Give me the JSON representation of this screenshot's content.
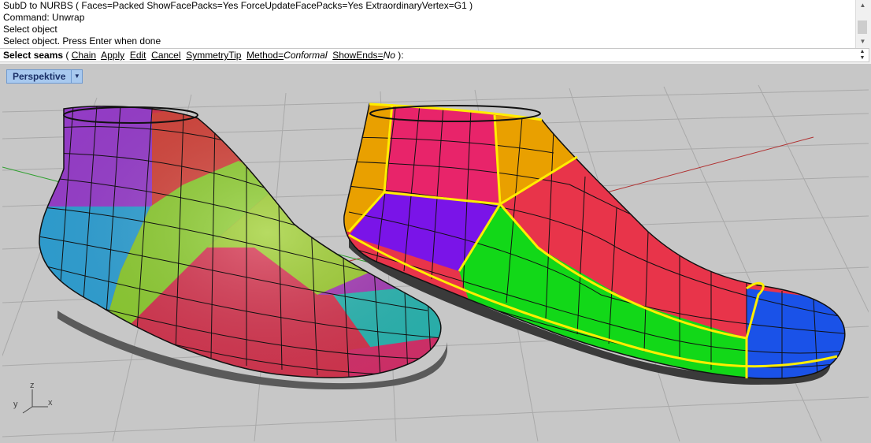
{
  "history": {
    "lines": [
      "SubD to NURBS ( Faces=Packed  ShowFacePacks=Yes  ForceUpdateFacePacks=Yes  ExtraordinaryVertex=G1 )",
      "Command: Unwrap",
      "Select object",
      "Select object. Press Enter when done"
    ]
  },
  "command": {
    "prompt": "Select seams",
    "open": " ( ",
    "options": [
      "Chain",
      "Apply",
      "Edit",
      "Cancel",
      "SymmetryTip"
    ],
    "method_label": "Method=",
    "method_value": "Conformal",
    "showends_label": "ShowEnds=",
    "showends_value": "No",
    "close": " ):"
  },
  "viewport": {
    "title": "Perspektive",
    "axis_labels": {
      "z": "z",
      "y": "y",
      "x": "x"
    }
  },
  "colors": {
    "viewport_bg": "#c7c7c7",
    "grid": "#a9a9a9",
    "tab_bg": "#a8c9ef",
    "seam": "#ffee00"
  }
}
